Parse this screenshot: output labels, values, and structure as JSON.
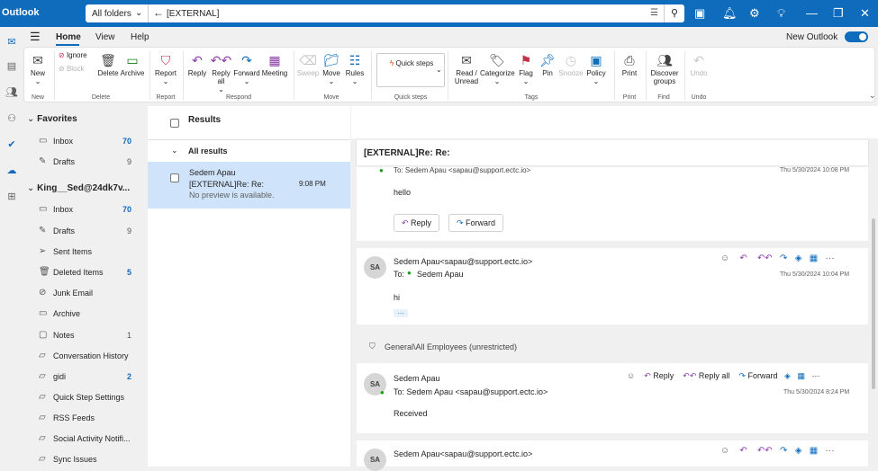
{
  "app": {
    "title": "Outlook"
  },
  "search": {
    "scope": "All folders",
    "query": "[EXTERNAL]"
  },
  "ribbon": {
    "tabs": [
      "Home",
      "View",
      "Help"
    ],
    "new_outlook": "New Outlook",
    "buttons": {
      "new": "New",
      "ignore": "Ignore",
      "block": "Block",
      "delete": "Delete",
      "archive": "Archive",
      "report": "Report",
      "reply": "Reply",
      "reply_all": "Reply all",
      "forward": "Forward",
      "meeting": "Meeting",
      "sweep": "Sweep",
      "move": "Move",
      "rules": "Rules",
      "quick_steps": "Quick steps",
      "read_unread": "Read / Unread",
      "categorize": "Categorize",
      "flag": "Flag",
      "pin": "Pin",
      "snooze": "Snooze",
      "policy": "Policy",
      "print": "Print",
      "discover_groups": "Discover groups",
      "undo": "Undo"
    },
    "groups": {
      "new": "New",
      "delete": "Delete",
      "report": "Report",
      "respond": "Respond",
      "move": "Move",
      "quick_steps": "Quick steps",
      "tags": "Tags",
      "print": "Print",
      "find": "Find",
      "undo": "Undo"
    }
  },
  "folders": {
    "favorites_header": "Favorites",
    "favorites": [
      {
        "name": "Inbox",
        "count": "70"
      },
      {
        "name": "Drafts",
        "count": "9"
      }
    ],
    "account": "King__Sed@24dk7v...",
    "items": [
      {
        "name": "Inbox",
        "count": "70"
      },
      {
        "name": "Drafts",
        "count": "9"
      },
      {
        "name": "Sent Items",
        "count": ""
      },
      {
        "name": "Deleted Items",
        "count": "5"
      },
      {
        "name": "Junk Email",
        "count": ""
      },
      {
        "name": "Archive",
        "count": ""
      },
      {
        "name": "Notes",
        "count": "1"
      },
      {
        "name": "Conversation History",
        "count": ""
      },
      {
        "name": "gidi",
        "count": "2"
      },
      {
        "name": "Quick Step Settings",
        "count": ""
      },
      {
        "name": "RSS Feeds",
        "count": ""
      },
      {
        "name": "Social Activity Notifi...",
        "count": ""
      },
      {
        "name": "Sync Issues",
        "count": ""
      }
    ]
  },
  "list": {
    "results_label": "Results",
    "all_results": "All results",
    "message": {
      "sender": "Sedem Apau",
      "subject": "[EXTERNAL]Re: Re:",
      "preview": "No preview is available.",
      "time": "9:08 PM"
    }
  },
  "reading": {
    "subject": "[EXTERNAL]Re: Re:",
    "card1": {
      "to": "To: Sedem Apau <sapau@support.ectc.io>",
      "date": "Thu 5/30/2024 10:08 PM",
      "body": "hello",
      "reply": "Reply",
      "forward": "Forward"
    },
    "card2": {
      "initials": "SA",
      "from": "Sedem Apau<sapau@support.ectc.io>",
      "to_prefix": "To:",
      "to": "Sedem Apau",
      "date": "Thu 5/30/2024 10:04 PM",
      "body": "hi",
      "more": "···"
    },
    "label": "General\\All Employees (unrestricted)",
    "card3": {
      "initials": "SA",
      "from": "Sedem Apau",
      "to": "To: Sedem Apau <sapau@support.ectc.io>",
      "date": "Thu 5/30/2024 8:24 PM",
      "body": "Received",
      "reply": "Reply",
      "reply_all": "Reply all",
      "forward": "Forward"
    },
    "card4": {
      "initials": "SA",
      "from": "Sedem Apau<sapau@support.ectc.io>"
    }
  },
  "colors": {
    "accent": "#0f6cbd",
    "presence": "#13a10e"
  }
}
